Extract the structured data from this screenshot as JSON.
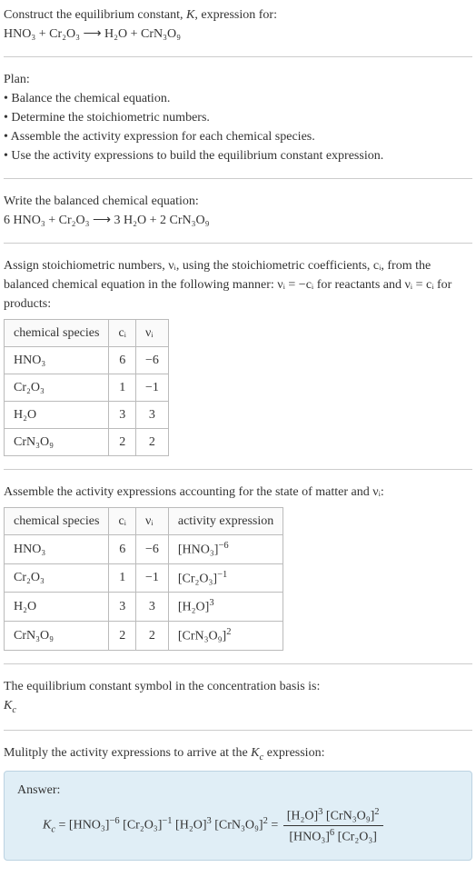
{
  "title_line1": "Construct the equilibrium constant, K, expression for:",
  "title_eq": "HNO₃ + Cr₂O₃ ⟶ H₂O + CrN₃O₉",
  "plan_heading": "Plan:",
  "plan_items": [
    "• Balance the chemical equation.",
    "• Determine the stoichiometric numbers.",
    "• Assemble the activity expression for each chemical species.",
    "• Use the activity expressions to build the equilibrium constant expression."
  ],
  "balanced_heading": "Write the balanced chemical equation:",
  "balanced_eq": "6 HNO₃ + Cr₂O₃ ⟶ 3 H₂O + 2 CrN₃O₉",
  "stoich_text": "Assign stoichiometric numbers, νᵢ, using the stoichiometric coefficients, cᵢ, from the balanced chemical equation in the following manner: νᵢ = −cᵢ for reactants and νᵢ = cᵢ for products:",
  "table1": {
    "headers": [
      "chemical species",
      "cᵢ",
      "νᵢ"
    ],
    "rows": [
      [
        "HNO₃",
        "6",
        "−6"
      ],
      [
        "Cr₂O₃",
        "1",
        "−1"
      ],
      [
        "H₂O",
        "3",
        "3"
      ],
      [
        "CrN₃O₉",
        "2",
        "2"
      ]
    ]
  },
  "assemble_text": "Assemble the activity expressions accounting for the state of matter and νᵢ:",
  "table2": {
    "headers": [
      "chemical species",
      "cᵢ",
      "νᵢ",
      "activity expression"
    ],
    "rows": [
      {
        "sp": "HNO₃",
        "c": "6",
        "v": "−6",
        "ae_base": "HNO₃",
        "ae_exp": "−6"
      },
      {
        "sp": "Cr₂O₃",
        "c": "1",
        "v": "−1",
        "ae_base": "Cr₂O₃",
        "ae_exp": "−1"
      },
      {
        "sp": "H₂O",
        "c": "3",
        "v": "3",
        "ae_base": "H₂O",
        "ae_exp": "3"
      },
      {
        "sp": "CrN₃O₉",
        "c": "2",
        "v": "2",
        "ae_base": "CrN₃O₉",
        "ae_exp": "2"
      }
    ]
  },
  "symbol_text1": "The equilibrium constant symbol in the concentration basis is:",
  "symbol_text2": "K",
  "symbol_sub": "c",
  "multiply_text": "Mulitply the activity expressions to arrive at the Kc expression:",
  "answer_label": "Answer:",
  "answer": {
    "lhs_sym": "K",
    "lhs_sub": "c",
    "terms": [
      {
        "base": "HNO₃",
        "exp": "−6"
      },
      {
        "base": "Cr₂O₃",
        "exp": "−1"
      },
      {
        "base": "H₂O",
        "exp": "3"
      },
      {
        "base": "CrN₃O₉",
        "exp": "2"
      }
    ],
    "frac_num": [
      {
        "base": "H₂O",
        "exp": "3"
      },
      {
        "base": "CrN₃O₉",
        "exp": "2"
      }
    ],
    "frac_den": [
      {
        "base": "HNO₃",
        "exp": "6"
      },
      {
        "base": "Cr₂O₃",
        "exp": ""
      }
    ]
  }
}
